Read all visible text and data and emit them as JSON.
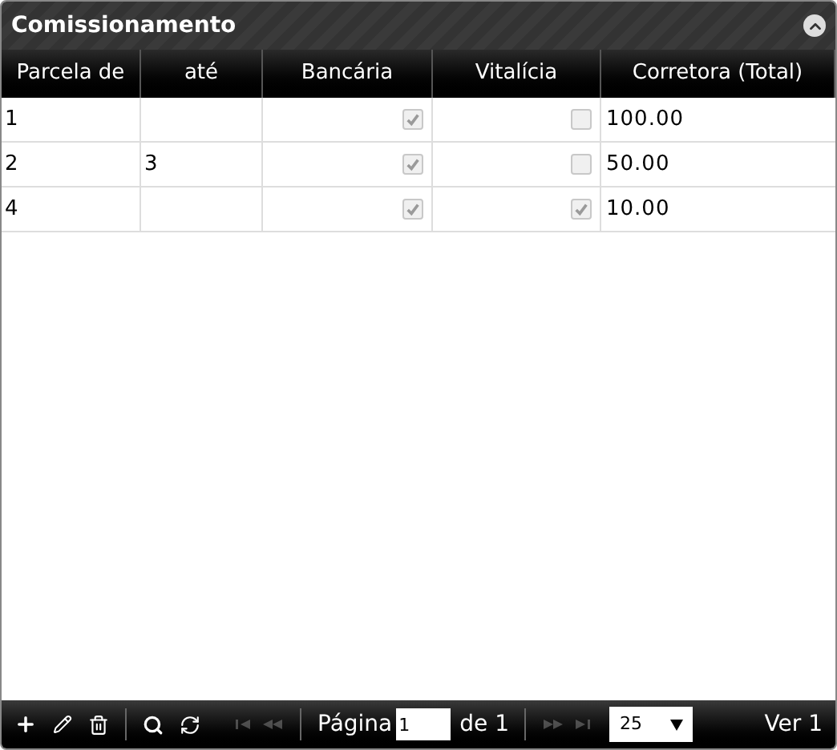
{
  "panel": {
    "title": "Comissionamento"
  },
  "table": {
    "columns": [
      "Parcela de",
      "até",
      "Bancária",
      "Vitalícia",
      "Corretora (Total)"
    ],
    "rows": [
      {
        "parcela_de": "1",
        "ate": "",
        "bancaria": true,
        "vitalicia": false,
        "corretora": "100.00"
      },
      {
        "parcela_de": "2",
        "ate": "3",
        "bancaria": true,
        "vitalicia": false,
        "corretora": "50.00"
      },
      {
        "parcela_de": "4",
        "ate": "",
        "bancaria": true,
        "vitalicia": true,
        "corretora": "10.00"
      }
    ]
  },
  "pager": {
    "page_label": "Página",
    "page": "1",
    "of_label": "de 1",
    "page_size": "25",
    "version": "Ver 1"
  }
}
